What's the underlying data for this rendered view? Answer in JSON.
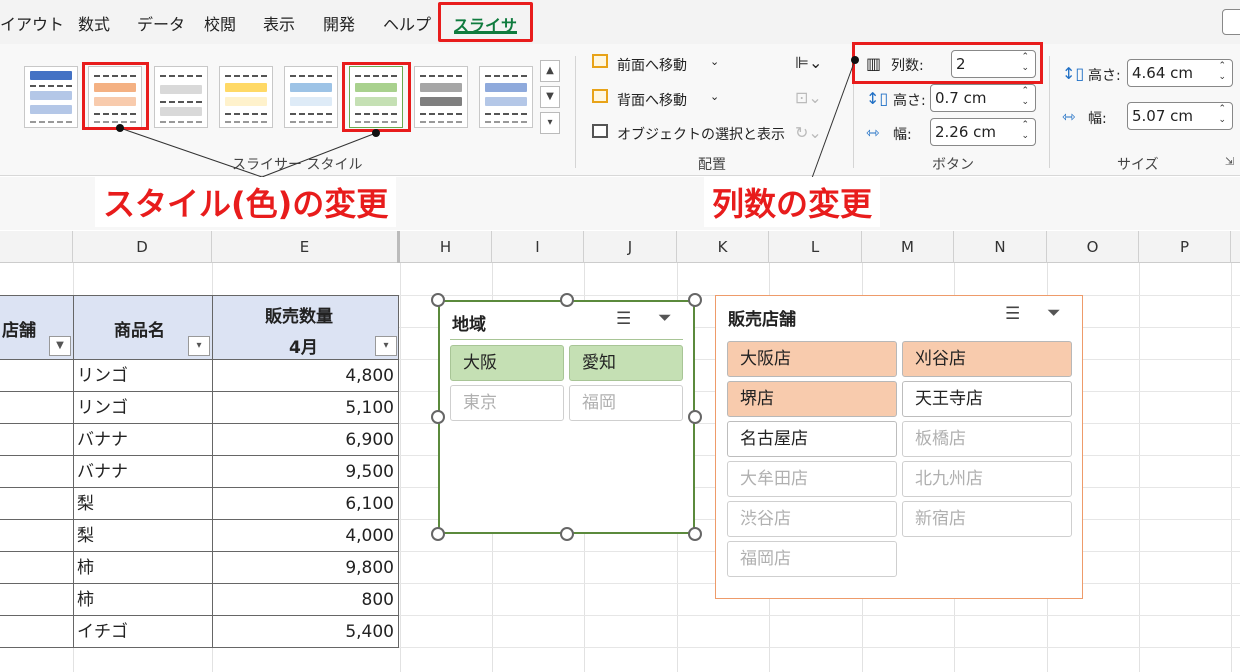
{
  "tabs": [
    "イアウト",
    "数式",
    "データ",
    "校閲",
    "表示",
    "開発",
    "ヘルプ"
  ],
  "active_tab": "スライサー",
  "ribbon": {
    "styles_group_label": "スライサー スタイル",
    "arrange": {
      "bring_forward": "前面へ移動",
      "send_backward": "背面へ移動",
      "selection_pane": "オブジェクトの選択と表示",
      "label": "配置"
    },
    "buttons": {
      "columns_label": "列数:",
      "columns_value": "2",
      "height_label": "高さ:",
      "height_value": "0.7 cm",
      "width_label": "幅:",
      "width_value": "2.26 cm",
      "label": "ボタン"
    },
    "size": {
      "height_label": "高さ:",
      "height_value": "4.64 cm",
      "width_label": "幅:",
      "width_value": "5.07 cm",
      "label": "サイズ"
    }
  },
  "annotations": {
    "style_change": "スタイル(色)の変更",
    "columns_change": "列数の変更"
  },
  "columns": [
    "D",
    "E",
    "H",
    "I",
    "J",
    "K",
    "L",
    "M",
    "N",
    "O",
    "P"
  ],
  "table": {
    "header_store": "店舗",
    "header_product": "商品名",
    "header_qty": "販売数量",
    "header_month": "4月",
    "rows": [
      {
        "product": "リンゴ",
        "qty": "4,800"
      },
      {
        "product": "リンゴ",
        "qty": "5,100"
      },
      {
        "product": "バナナ",
        "qty": "6,900"
      },
      {
        "product": "バナナ",
        "qty": "9,500"
      },
      {
        "product": "梨",
        "qty": "6,100"
      },
      {
        "product": "梨",
        "qty": "4,000"
      },
      {
        "product": "柿",
        "qty": "9,800"
      },
      {
        "product": "柿",
        "qty": "800"
      },
      {
        "product": "イチゴ",
        "qty": "5,400"
      }
    ]
  },
  "slicer_region": {
    "title": "地域",
    "items": [
      "大阪",
      "愛知",
      "東京",
      "福岡"
    ]
  },
  "slicer_store": {
    "title": "販売店舗",
    "items": [
      "大阪店",
      "刈谷店",
      "堺店",
      "天王寺店",
      "名古屋店",
      "板橋店",
      "大牟田店",
      "北九州店",
      "渋谷店",
      "新宿店",
      "福岡店"
    ]
  }
}
